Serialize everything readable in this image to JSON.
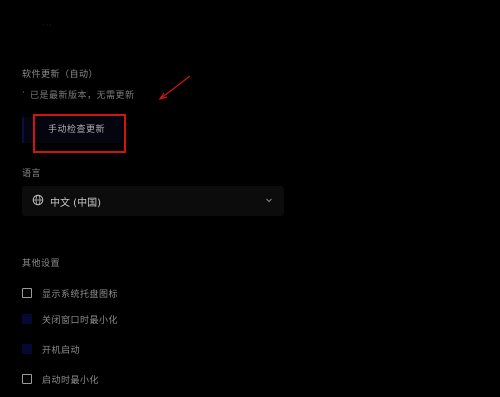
{
  "header": {
    "faint_label": "⋯"
  },
  "update": {
    "section_title": "软件更新（自动）",
    "description_bullet": "·",
    "description": "已是最新版本，无需更新",
    "check_button_label": "手动检查更新"
  },
  "language": {
    "section_title": "语言",
    "selected_value": "中文 (中国)"
  },
  "other": {
    "section_title": "其他设置",
    "options": [
      {
        "label": "显示系统托盘图标",
        "checked": false
      },
      {
        "label": "关闭窗口时最小化",
        "checked": true
      },
      {
        "label": "开机启动",
        "checked": true
      },
      {
        "label": "启动时最小化",
        "checked": false
      }
    ]
  },
  "colors": {
    "background": "#000000",
    "annotation_red": "#d01414",
    "accent_dark_blue": "#070733"
  }
}
